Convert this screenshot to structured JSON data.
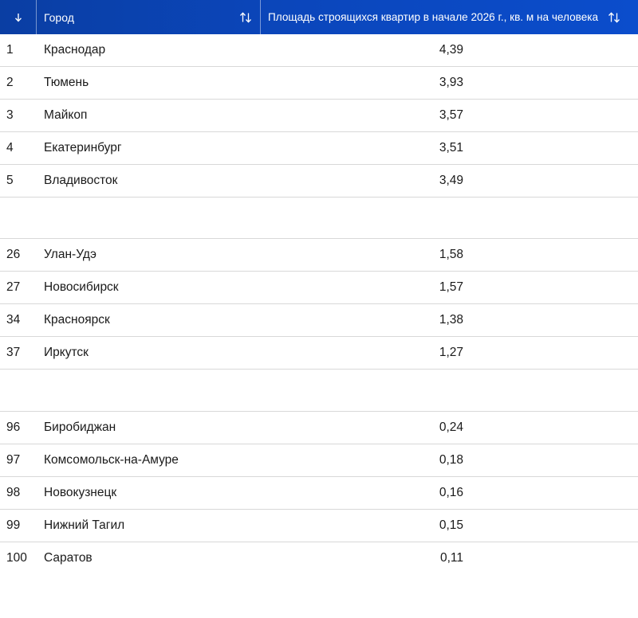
{
  "header": {
    "rank_icon": "arrow-down-icon",
    "city_label": "Город",
    "value_label": "Площадь строящихся квартир в начале 2026 г., кв. м на человека",
    "sort_icon": "sort-updown-icon"
  },
  "groups": [
    [
      {
        "rank": "1",
        "city": "Краснодар",
        "value": "4,39"
      },
      {
        "rank": "2",
        "city": "Тюмень",
        "value": "3,93"
      },
      {
        "rank": "3",
        "city": "Майкоп",
        "value": "3,57"
      },
      {
        "rank": "4",
        "city": "Екатеринбург",
        "value": "3,51"
      },
      {
        "rank": "5",
        "city": "Владивосток",
        "value": "3,49"
      }
    ],
    [
      {
        "rank": "26",
        "city": "Улан-Удэ",
        "value": "1,58"
      },
      {
        "rank": "27",
        "city": "Новосибирск",
        "value": "1,57"
      },
      {
        "rank": "34",
        "city": "Красноярск",
        "value": "1,38"
      },
      {
        "rank": "37",
        "city": "Иркутск",
        "value": "1,27"
      }
    ],
    [
      {
        "rank": "96",
        "city": "Биробиджан",
        "value": "0,24"
      },
      {
        "rank": "97",
        "city": "Комсомольск-на-Амуре",
        "value": "0,18"
      },
      {
        "rank": "98",
        "city": "Новокузнецк",
        "value": "0,16"
      },
      {
        "rank": "99",
        "city": "Нижний Тагил",
        "value": "0,15"
      },
      {
        "rank": "100",
        "city": "Саратов",
        "value": "0,11"
      }
    ]
  ],
  "colors": {
    "header_bg": "#0b46bb",
    "header_text": "#ffffff",
    "divider": "#d8d8d8"
  }
}
